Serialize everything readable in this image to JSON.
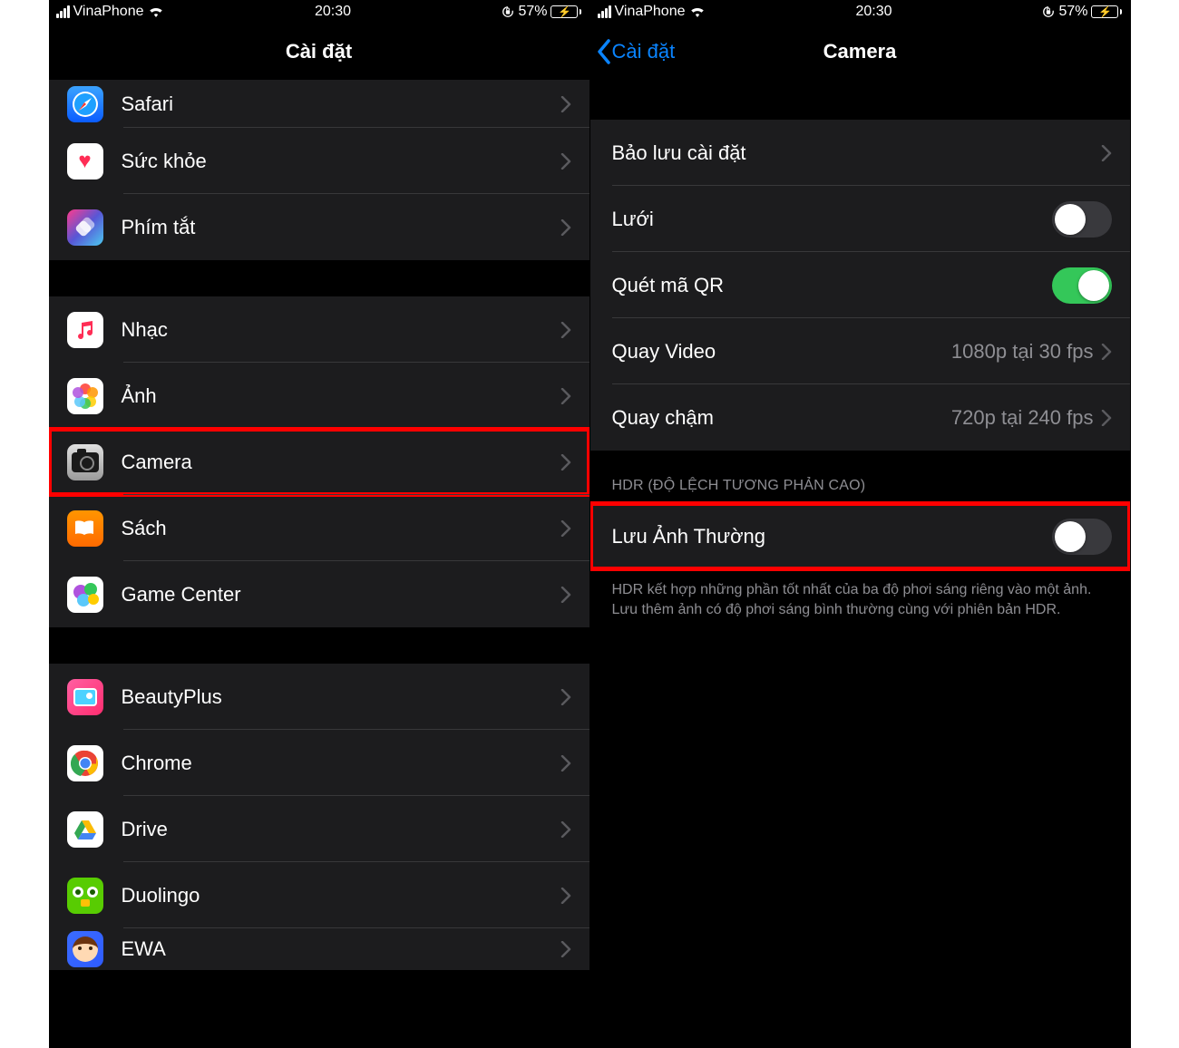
{
  "status": {
    "carrier": "VinaPhone",
    "time": "20:30",
    "battery_pct": "57%"
  },
  "left": {
    "title": "Cài đặt",
    "items": {
      "safari": "Safari",
      "health": "Sức khỏe",
      "shortcuts": "Phím tắt",
      "music": "Nhạc",
      "photos": "Ảnh",
      "camera": "Camera",
      "books": "Sách",
      "gamecenter": "Game Center",
      "beautyplus": "BeautyPlus",
      "chrome": "Chrome",
      "drive": "Drive",
      "duolingo": "Duolingo",
      "ewa": "EWA"
    }
  },
  "right": {
    "back": "Cài đặt",
    "title": "Camera",
    "rows": {
      "preserve": "Bảo lưu cài đặt",
      "grid": "Lưới",
      "qr": "Quét mã QR",
      "video": "Quay Video",
      "video_val": "1080p tại 30 fps",
      "slomo": "Quay chậm",
      "slomo_val": "720p tại 240 fps"
    },
    "hdr_header": "HDR (ĐỘ LỆCH TƯƠNG PHẢN CAO)",
    "hdr_row": "Lưu Ảnh Thường",
    "hdr_footer": "HDR kết hợp những phần tốt nhất của ba độ phơi sáng riêng vào một ảnh. Lưu thêm ảnh có độ phơi sáng bình thường cùng với phiên bản HDR."
  }
}
